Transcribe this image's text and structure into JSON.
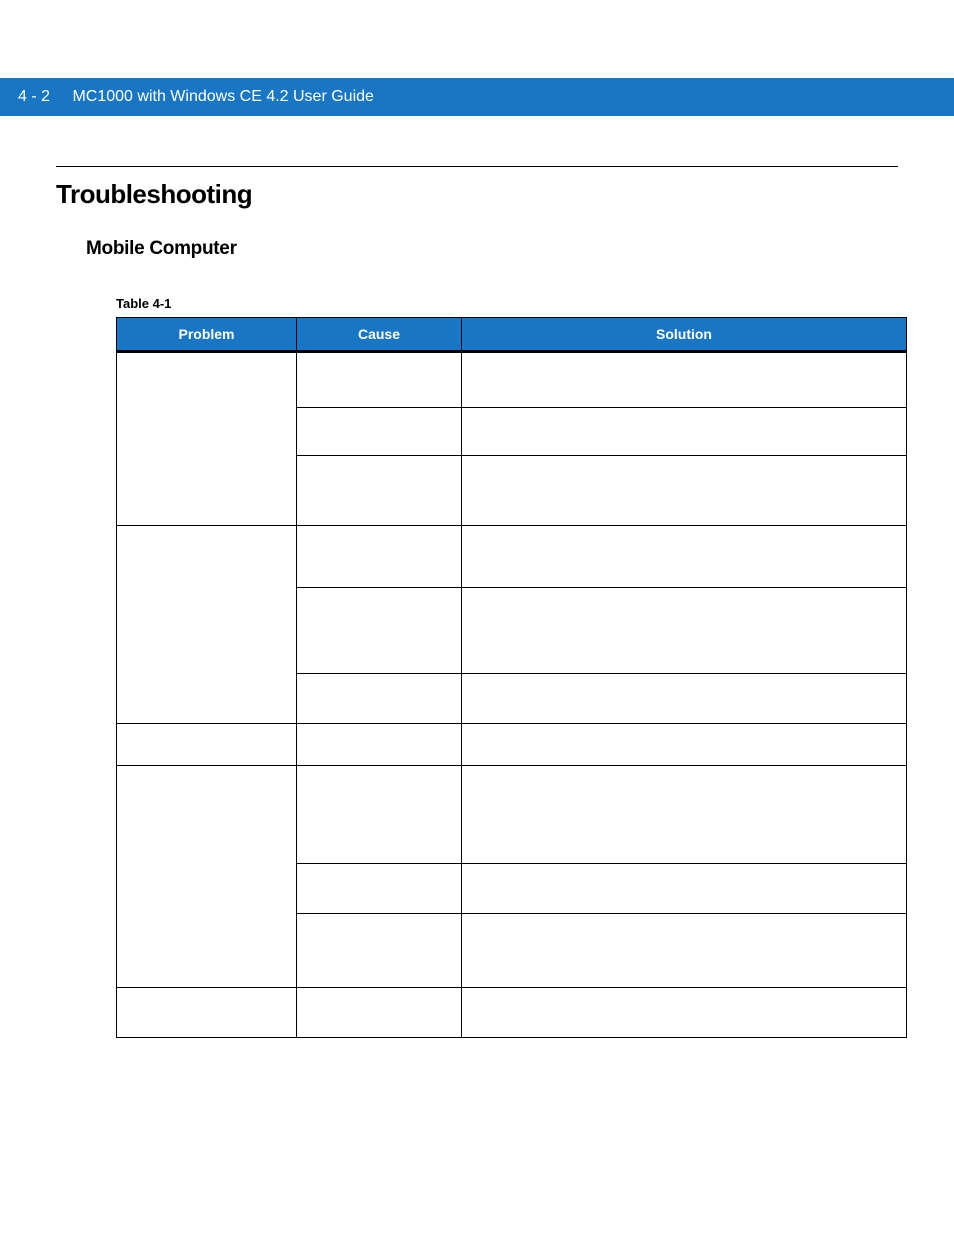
{
  "header": {
    "page_num": "4 - 2",
    "doc_title": "MC1000 with Windows CE 4.2 User Guide"
  },
  "section": {
    "title": "Troubleshooting",
    "subtitle": "Mobile Computer"
  },
  "table": {
    "caption": "Table 4-1",
    "headers": {
      "problem": "Problem",
      "cause": "Cause",
      "solution": "Solution"
    },
    "rows": [
      {
        "problem": "",
        "cause": "",
        "solution": ""
      },
      {
        "problem": "",
        "cause": "",
        "solution": ""
      },
      {
        "problem": "",
        "cause": "",
        "solution": ""
      },
      {
        "problem": "",
        "cause": "",
        "solution": ""
      },
      {
        "problem": "",
        "cause": "",
        "solution": ""
      },
      {
        "problem": "",
        "cause": "",
        "solution": ""
      },
      {
        "problem": "",
        "cause": "",
        "solution": ""
      },
      {
        "problem": "",
        "cause": "",
        "solution": ""
      },
      {
        "problem": "",
        "cause": "",
        "solution": ""
      },
      {
        "problem": "",
        "cause": "",
        "solution": ""
      },
      {
        "problem": "",
        "cause": "",
        "solution": ""
      }
    ]
  }
}
